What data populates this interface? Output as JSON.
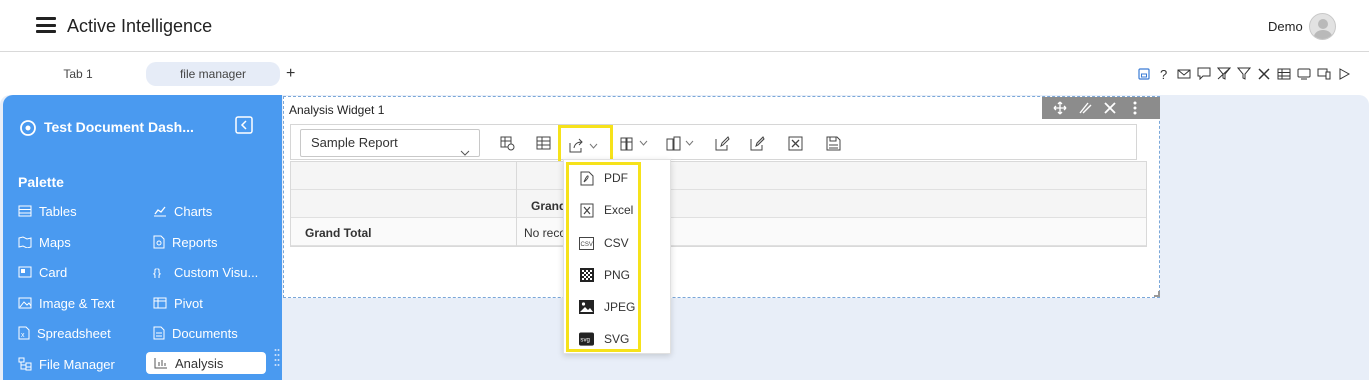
{
  "header": {
    "app_title": "Active Intelligence",
    "user_name": "Demo"
  },
  "tabs": [
    {
      "label": "Tab 1"
    },
    {
      "label": "file manager"
    }
  ],
  "tab_add_label": "+",
  "sidebar": {
    "dashboard_name": "Test Document Dash...",
    "palette_title": "Palette",
    "items": [
      {
        "label": "Tables",
        "icon": "table-icon"
      },
      {
        "label": "Charts",
        "icon": "chart-icon"
      },
      {
        "label": "Maps",
        "icon": "map-icon"
      },
      {
        "label": "Reports",
        "icon": "report-icon"
      },
      {
        "label": "Card",
        "icon": "card-icon"
      },
      {
        "label": "Custom Visu...",
        "icon": "code-icon"
      },
      {
        "label": "Image & Text",
        "icon": "image-icon"
      },
      {
        "label": "Pivot",
        "icon": "pivot-icon"
      },
      {
        "label": "Spreadsheet",
        "icon": "spreadsheet-icon"
      },
      {
        "label": "Documents",
        "icon": "document-icon"
      },
      {
        "label": "File Manager",
        "icon": "file-manager-icon"
      },
      {
        "label": "Analysis",
        "icon": "analysis-icon"
      }
    ]
  },
  "widget": {
    "title": "Analysis Widget 1",
    "report_select_value": "Sample Report",
    "pivot": {
      "col_header": "Grand",
      "row_label": "Grand Total",
      "cell_value": "No reco"
    }
  },
  "export_menu": {
    "items": [
      {
        "label": "PDF",
        "icon": "pdf-icon"
      },
      {
        "label": "Excel",
        "icon": "excel-icon"
      },
      {
        "label": "CSV",
        "icon": "csv-icon"
      },
      {
        "label": "PNG",
        "icon": "png-icon"
      },
      {
        "label": "JPEG",
        "icon": "jpeg-icon"
      },
      {
        "label": "SVG",
        "icon": "svg-icon"
      }
    ],
    "csv_icon_text": "CSV",
    "svg_icon_text": "svg"
  },
  "colors": {
    "sidebar": "#4a9af0",
    "canvas": "#e8eef8",
    "highlight": "#f6e21a",
    "active_tab": "#e6ecf7",
    "widget_tools": "#8c8c8c"
  }
}
